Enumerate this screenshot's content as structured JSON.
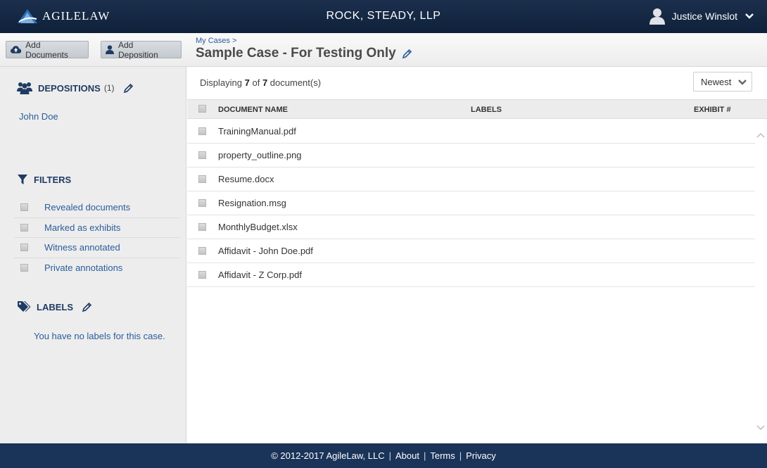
{
  "header": {
    "logo_text": "AGILELAW",
    "firm_name": "ROCK, STEADY, LLP",
    "user_name": "Justice Winslot"
  },
  "toolbar": {
    "add_documents_label": "Add Documents",
    "add_deposition_label": "Add Deposition"
  },
  "case": {
    "breadcrumb": "My Cases >",
    "title": "Sample Case - For Testing Only"
  },
  "sidebar": {
    "depositions": {
      "heading": "DEPOSITIONS",
      "count": "(1)",
      "items": [
        {
          "label": "John Doe"
        }
      ]
    },
    "filters": {
      "heading": "FILTERS",
      "items": [
        {
          "label": "Revealed documents"
        },
        {
          "label": "Marked as exhibits"
        },
        {
          "label": "Witness annotated"
        },
        {
          "label": "Private annotations"
        }
      ]
    },
    "labels": {
      "heading": "LABELS",
      "empty_text": "You have no labels for this case."
    }
  },
  "main": {
    "displaying_prefix": "Displaying",
    "shown_count": "7",
    "of_text": "of",
    "total_count": "7",
    "displaying_suffix": "document(s)",
    "sort_selected": "Newest",
    "columns": {
      "name": "DOCUMENT NAME",
      "labels": "LABELS",
      "exhibit": "EXHIBIT #"
    },
    "documents": [
      {
        "name": "TrainingManual.pdf"
      },
      {
        "name": "property_outline.png"
      },
      {
        "name": "Resume.docx"
      },
      {
        "name": "Resignation.msg"
      },
      {
        "name": "MonthlyBudget.xlsx"
      },
      {
        "name": "Affidavit - John Doe.pdf"
      },
      {
        "name": "Affidavit - Z Corp.pdf"
      }
    ]
  },
  "footer": {
    "copyright": "© 2012-2017 AgileLaw, LLC",
    "separator": "|",
    "links": [
      "About",
      "Terms",
      "Privacy"
    ]
  },
  "colors": {
    "header_bg": "#12243f",
    "footer_bg": "#1a3358",
    "link_blue": "#2a5d9a",
    "heading_navy": "#1f3b63"
  }
}
